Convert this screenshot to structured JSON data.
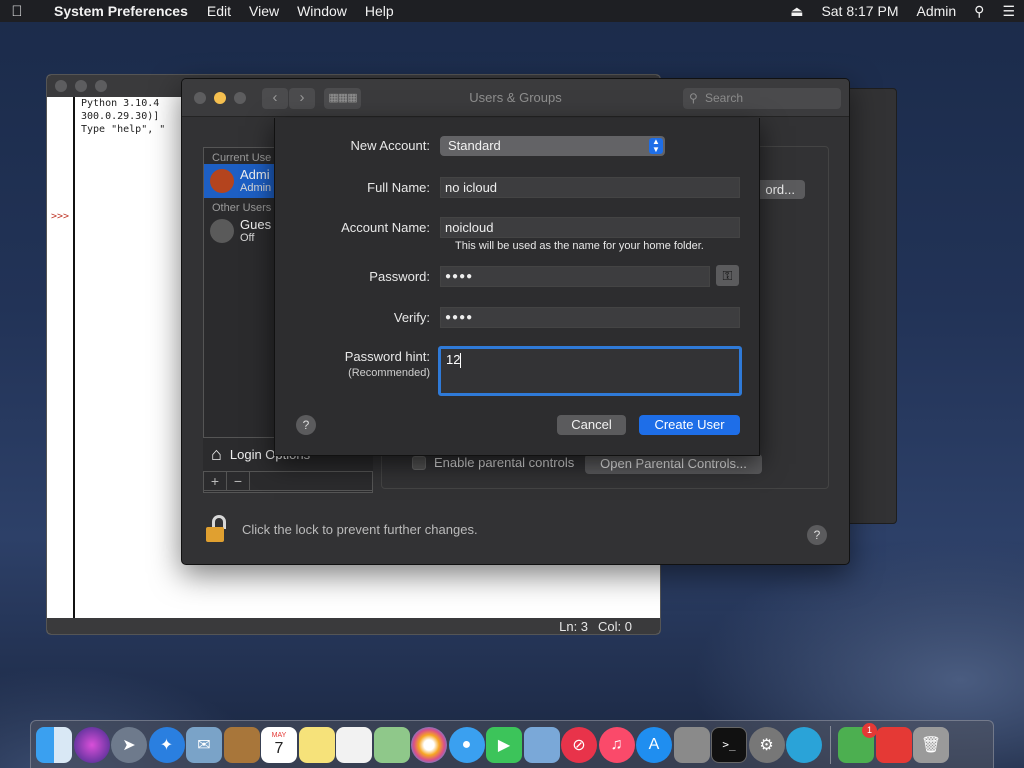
{
  "menubar": {
    "app": "System Preferences",
    "items": [
      "Edit",
      "View",
      "Window",
      "Help"
    ],
    "clock": "Sat 8:17 PM",
    "user": "Admin"
  },
  "python_window": {
    "lines": [
      "Python 3.10.4",
      "300.0.29.30)] ",
      "Type \"help\", \""
    ],
    "prompt": ">>>",
    "status_ln": "Ln: 3",
    "status_col": "Col: 0"
  },
  "sysprefs": {
    "title": "Users & Groups",
    "search_placeholder": "Search",
    "current_users_heading": "Current Use",
    "admin_name": "Admi",
    "admin_role": "Admin",
    "other_users_heading": "Other Users",
    "guest_name": "Gues",
    "guest_status": "Off",
    "login_options": "Login Options",
    "password_button": "ord...",
    "enable_parental": "Enable parental controls",
    "open_parental": "Open Parental Controls...",
    "lock_text": "Click the lock to prevent further changes."
  },
  "sheet": {
    "new_account_label": "New Account:",
    "new_account_value": "Standard",
    "full_name_label": "Full Name:",
    "full_name_value": "no icloud",
    "account_name_label": "Account Name:",
    "account_name_value": "noicloud",
    "account_name_note": "This will be used as the name for your home folder.",
    "password_label": "Password:",
    "password_value": "●●●●",
    "verify_label": "Verify:",
    "verify_value": "●●●●",
    "hint_label": "Password hint:",
    "hint_sub": "(Recommended)",
    "hint_value": "12",
    "cancel": "Cancel",
    "create": "Create User"
  },
  "dock": {
    "calendar_month": "MAY",
    "calendar_day": "7",
    "app_store_badge": "1"
  }
}
